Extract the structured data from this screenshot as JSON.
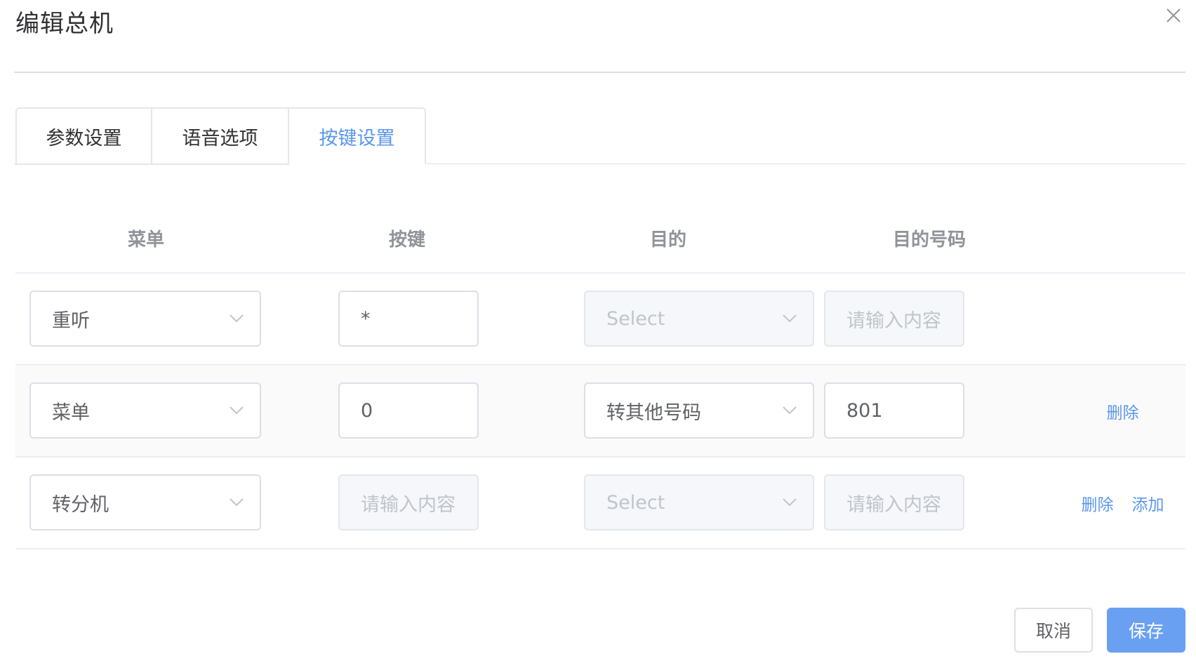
{
  "dialog": {
    "title": "编辑总机",
    "close_icon": "close-icon"
  },
  "tabs": [
    {
      "label": "参数设置",
      "active": false
    },
    {
      "label": "语音选项",
      "active": false
    },
    {
      "label": "按键设置",
      "active": true
    }
  ],
  "table": {
    "headers": [
      "菜单",
      "按键",
      "目的",
      "目的号码",
      ""
    ],
    "rows": [
      {
        "menu": "重听",
        "key": {
          "value": "*",
          "placeholder": "请输入内容",
          "disabled": false
        },
        "target": {
          "value": "",
          "placeholder": "Select",
          "disabled": true
        },
        "number": {
          "value": "",
          "placeholder": "请输入内容",
          "disabled": true
        },
        "actions": []
      },
      {
        "menu": "菜单",
        "key": {
          "value": "0",
          "placeholder": "请输入内容",
          "disabled": false
        },
        "target": {
          "value": "转其他号码",
          "placeholder": "Select",
          "disabled": false
        },
        "number": {
          "value": "801",
          "placeholder": "请输入内容",
          "disabled": false
        },
        "actions": [
          "删除"
        ]
      },
      {
        "menu": "转分机",
        "key": {
          "value": "",
          "placeholder": "请输入内容",
          "disabled": true
        },
        "target": {
          "value": "",
          "placeholder": "Select",
          "disabled": true
        },
        "number": {
          "value": "",
          "placeholder": "请输入内容",
          "disabled": true
        },
        "actions": [
          "删除",
          "添加"
        ]
      }
    ]
  },
  "footer": {
    "cancel_label": "取消",
    "save_label": "保存"
  },
  "colors": {
    "accent": "#5b96ec",
    "primary_button": "#6aa0f2",
    "border": "#dcdfe6",
    "disabled_bg": "#f5f7fa",
    "placeholder": "#c0c4cc"
  }
}
